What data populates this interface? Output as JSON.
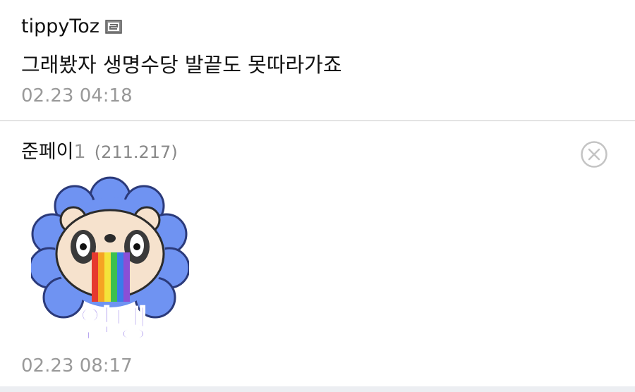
{
  "comments": [
    {
      "author": "tippyToz",
      "badge_icon": "member-badge-icon",
      "text": "그래봤자 생명수당 발끝도 못따라가죠",
      "time": "02.23 04:18"
    },
    {
      "author": "준페이",
      "author_suffix": "1",
      "ip": "(211.217)",
      "sticker_text": "얼탱",
      "time": "02.23 08:17",
      "delete_icon": "circle-x-icon"
    }
  ],
  "colors": {
    "divider": "#e3e3e3",
    "muted": "#999999",
    "sticker_blue": "#6f93f2",
    "sticker_purple": "#8b6fe6"
  }
}
